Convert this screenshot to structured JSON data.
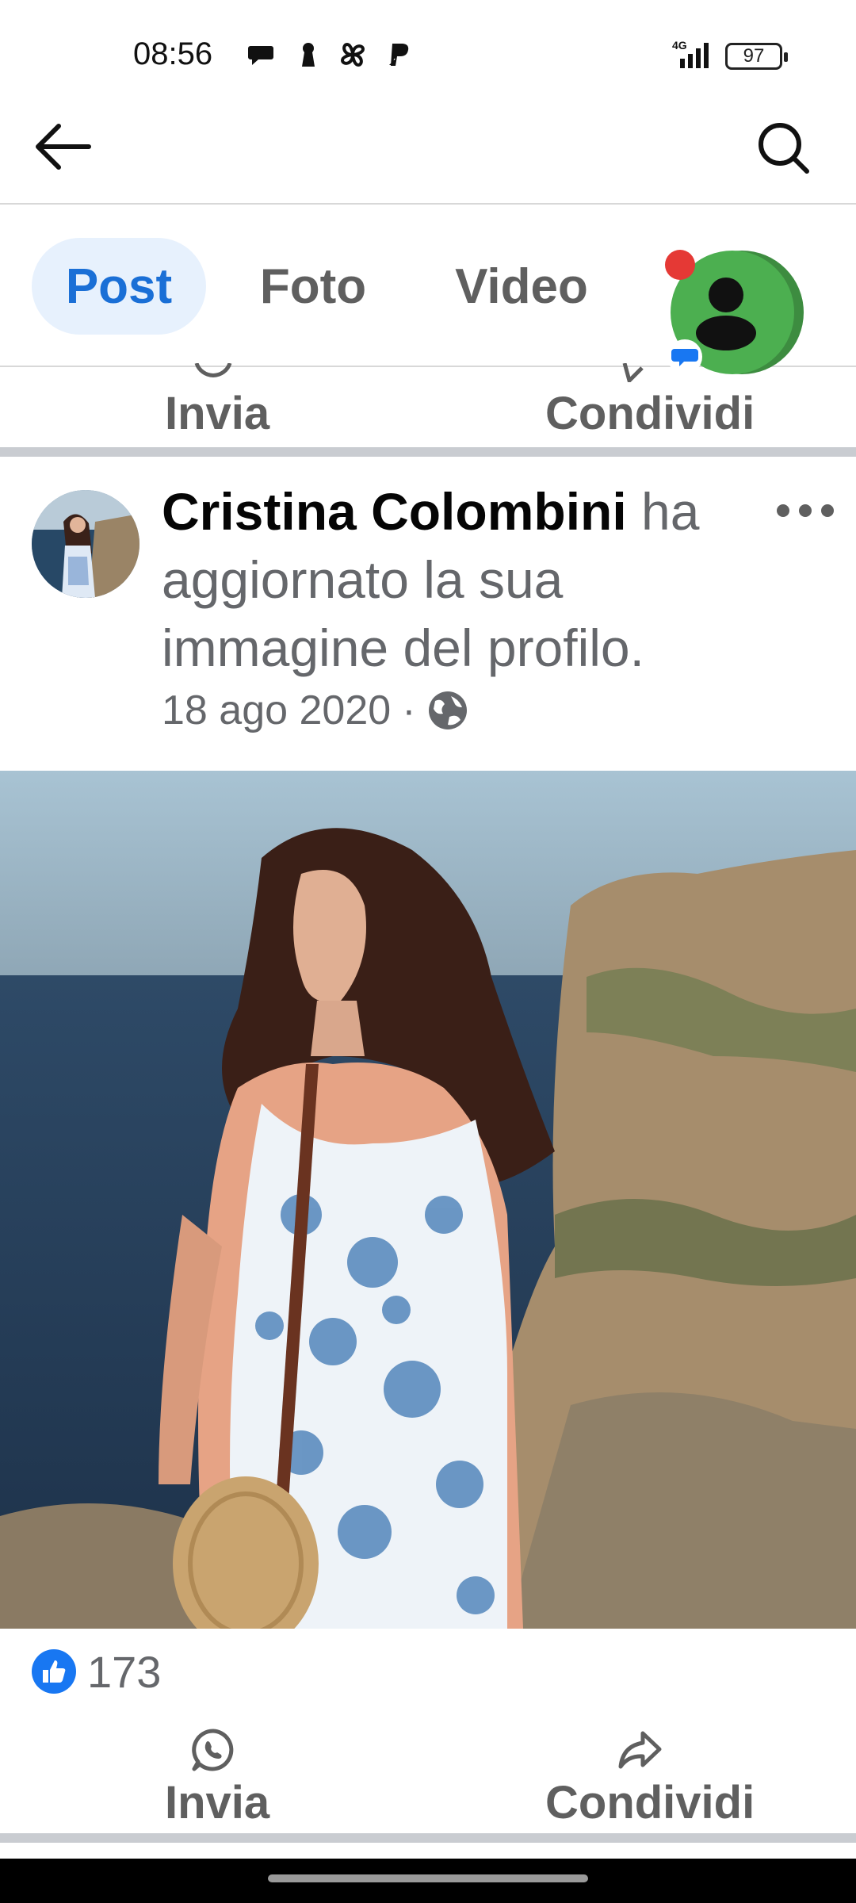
{
  "status_bar": {
    "time": "08:56",
    "network": "4G",
    "battery": "97",
    "icons": [
      "chat-bubble-icon",
      "keyhole-icon",
      "pinwheel-icon",
      "paypal-icon"
    ]
  },
  "header": {
    "back_icon": "arrow-left-icon",
    "search_icon": "search-icon"
  },
  "tabs": [
    {
      "label": "Post",
      "active": true
    },
    {
      "label": "Foto",
      "active": false
    },
    {
      "label": "Video",
      "active": false
    }
  ],
  "top_actions": {
    "send_label": "Invia",
    "share_label": "Condividi"
  },
  "post": {
    "author": "Cristina Colombini",
    "action_text": " ha aggiornato la sua immagine del profilo.",
    "date": "18 ago 2020",
    "separator": " · ",
    "privacy_icon": "globe-icon",
    "like_count": "173"
  },
  "bottom_actions": {
    "send_label": "Invia",
    "share_label": "Condividi"
  },
  "colors": {
    "accent": "#1a6fd6",
    "tab_active_bg": "#e7f1fd",
    "muted_text": "#65676b",
    "separator": "#c9ccd1",
    "like_blue": "#1877f2",
    "chat_green": "#4caf50"
  }
}
